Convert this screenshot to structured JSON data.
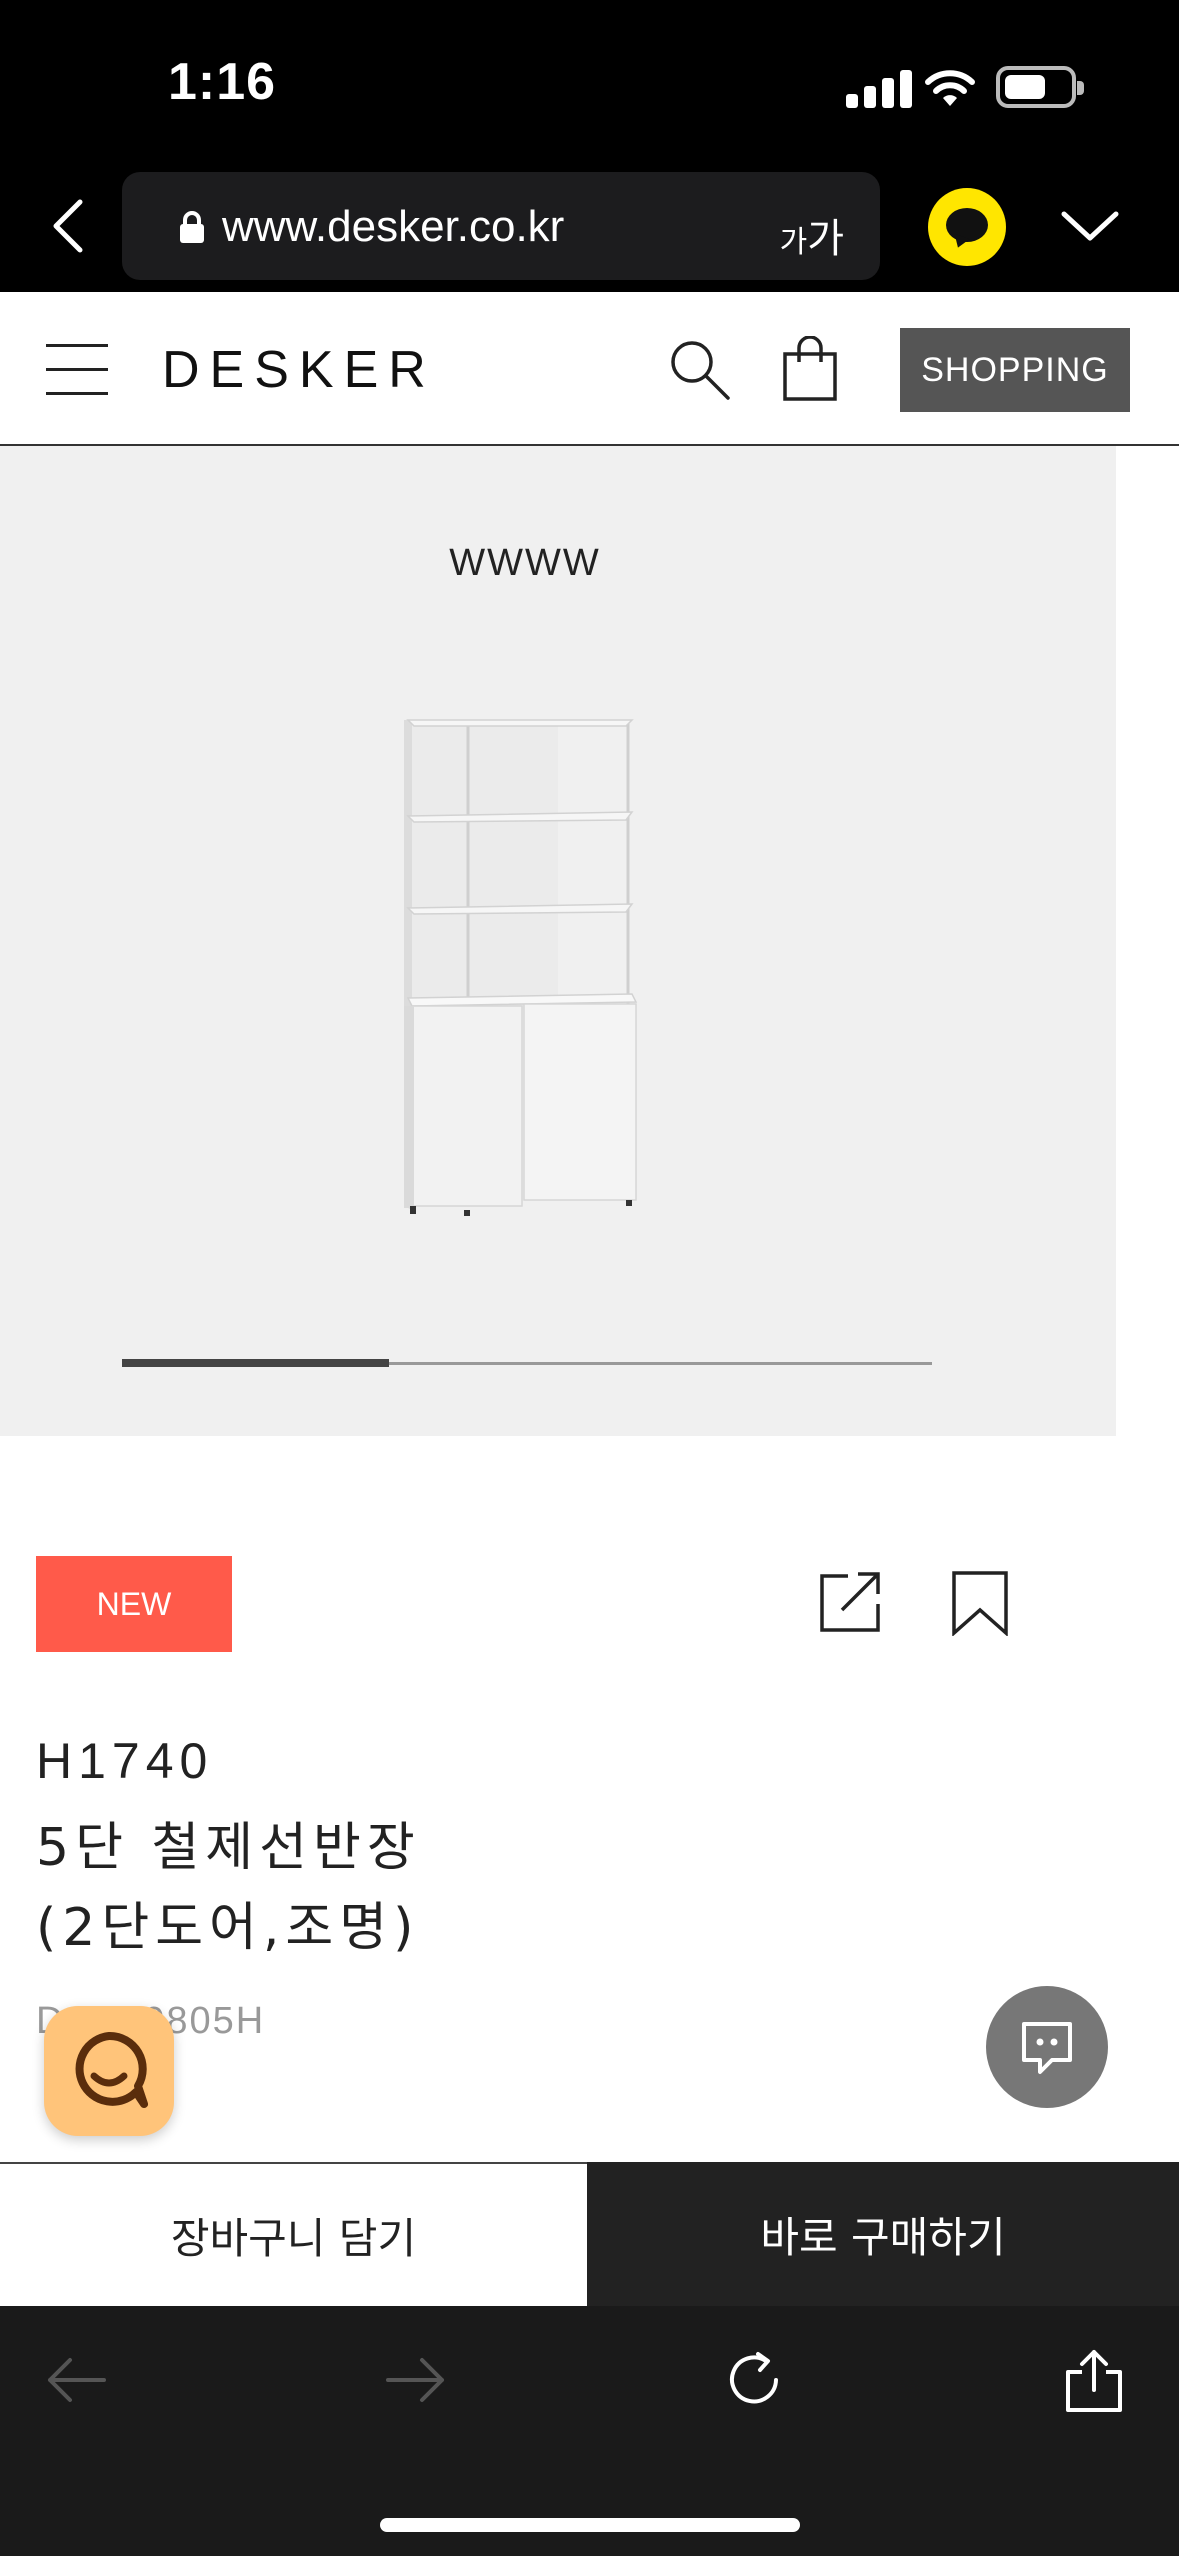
{
  "status_bar": {
    "time": "1:16"
  },
  "browser": {
    "url": "www.desker.co.kr",
    "text_size_small": "가",
    "text_size_large": "가"
  },
  "header": {
    "logo": "DESKER",
    "shopping_label": "SHOPPING"
  },
  "gallery": {
    "watermark": "WWWW",
    "progress_fraction": 0.33
  },
  "product": {
    "badge": "NEW",
    "size": "H1740",
    "name_line1": "5단 철제선반장",
    "name_line2": "(2단도어,조명)",
    "code": "DSB80805H"
  },
  "actions": {
    "cart_label": "장바구니 담기",
    "buy_label": "바로 구매하기"
  },
  "colors": {
    "badge": "#ff5a4a",
    "kakao": "#ffe600",
    "chatbot": "#ffc47a",
    "buy_button": "#222222"
  }
}
